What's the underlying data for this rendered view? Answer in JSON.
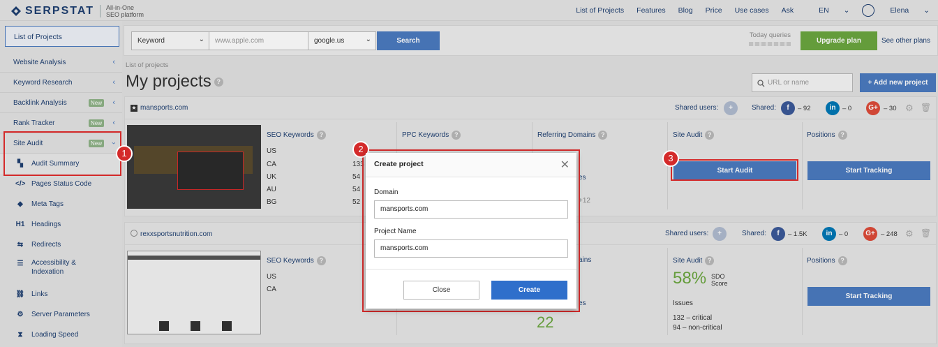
{
  "header": {
    "logo": "SERPSTAT",
    "tagline_1": "All-in-One",
    "tagline_2": "SEO platform",
    "nav": [
      "List of Projects",
      "Features",
      "Blog",
      "Price",
      "Use cases",
      "Ask",
      "EN"
    ],
    "user": "Elena"
  },
  "sidebar": {
    "list_of_projects": "List of Projects",
    "items": [
      {
        "label": "Website Analysis"
      },
      {
        "label": "Keyword Research"
      },
      {
        "label": "Backlink Analysis",
        "badge": "New"
      },
      {
        "label": "Rank Tracker",
        "badge": "New"
      },
      {
        "label": "Site Audit",
        "badge": "New"
      }
    ],
    "subitems": [
      {
        "label": "Audit Summary",
        "icon": "audit-summary-icon"
      },
      {
        "label": "Pages Status Code",
        "icon": "code-icon"
      },
      {
        "label": "Meta Tags",
        "icon": "tag-icon"
      },
      {
        "label": "Headings",
        "icon": "h1-icon"
      },
      {
        "label": "Redirects",
        "icon": "redirect-icon"
      },
      {
        "label": "Accessibility &",
        "label2": "Indexation",
        "icon": "list-icon"
      },
      {
        "label": "Links",
        "icon": "link-icon"
      },
      {
        "label": "Server Parameters",
        "icon": "server-icon"
      },
      {
        "label": "Loading Speed",
        "icon": "hourglass-icon"
      }
    ]
  },
  "search": {
    "type": "Keyword",
    "placeholder": "www.apple.com",
    "engine": "google.us",
    "button": "Search",
    "today_queries": "Today queries",
    "upgrade": "Upgrade plan",
    "other_plans": "See other plans"
  },
  "page": {
    "breadcrumb": "List of projects",
    "title": "My projects",
    "url_placeholder": "URL or name",
    "add_project": "+ Add new project"
  },
  "projects": [
    {
      "domain": "mansports.com",
      "shared_users": "Shared users:",
      "shared": "Shared:",
      "fb": "– 92",
      "li": "– 0",
      "gp": "– 30",
      "seo_keywords": "SEO Keywords",
      "countries": [
        "US",
        "CA",
        "UK",
        "AU",
        "BG"
      ],
      "counts": [
        "",
        "133",
        "54",
        "54",
        "52"
      ],
      "ppc_keywords": "PPC Keywords",
      "referring_domains": "Referring Domains",
      "site_audit": "Site Audit",
      "start_audit": "Start Audit",
      "positions": "Positions",
      "start_tracking": "Start Tracking",
      "plus": "+12",
      "partial_es": "es"
    },
    {
      "domain": "rexxsportsnutrition.com",
      "shared_users": "Shared users:",
      "shared": "Shared:",
      "fb": "– 1.5K",
      "li": "– 0",
      "gp": "– 248",
      "seo_keywords": "SEO Keywords",
      "countries": [
        "US",
        "CA"
      ],
      "referring_partial": "ains",
      "partial_es": "es",
      "big_number": "22",
      "site_audit": "Site Audit",
      "sdo_percent": "58%",
      "sdo_1": "SDO",
      "sdo_2": "Score",
      "issues": "Issues",
      "critical": "132 – critical",
      "non_critical": "94 – non-critical",
      "positions": "Positions",
      "start_tracking": "Start Tracking"
    }
  ],
  "modal": {
    "title": "Create project",
    "domain_label": "Domain",
    "domain_value": "mansports.com",
    "name_label": "Project Name",
    "name_value": "mansports.com",
    "close": "Close",
    "create": "Create"
  },
  "annotations": {
    "n1": "1",
    "n2": "2",
    "n3": "3"
  },
  "colors": {
    "brand": "#1e3f71",
    "accent": "#4b7bc0",
    "upgrade": "#6ba63f",
    "highlight": "#d42a2a",
    "create": "#2f6fcb"
  }
}
